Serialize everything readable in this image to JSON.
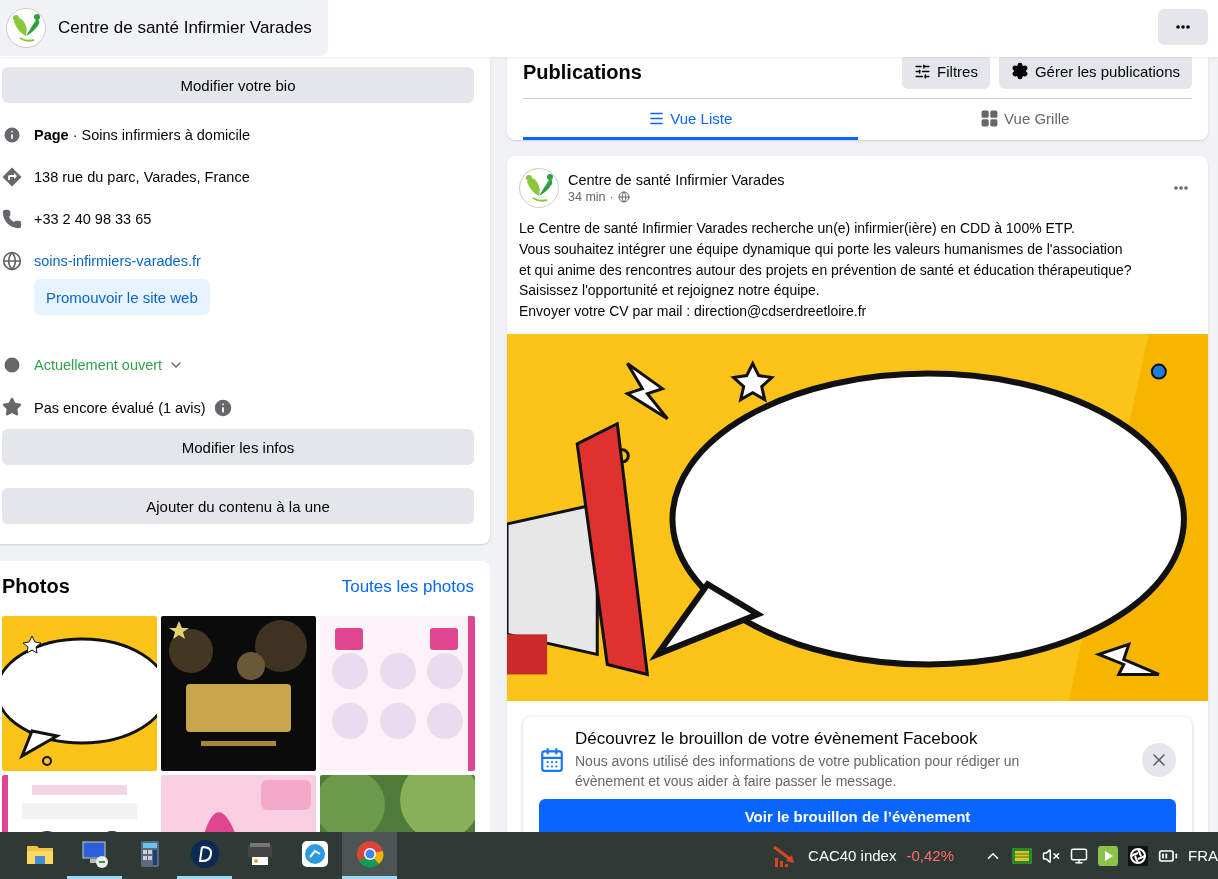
{
  "header": {
    "page_name": "Centre de santé Infirmier Varades"
  },
  "intro": {
    "edit_bio_button": "Modifier votre bio",
    "details": [
      {
        "kind": "category",
        "text": "**Page** · Soins infirmiers à domicile"
      },
      {
        "kind": "address",
        "text": "138 rue du parc, Varades, France"
      },
      {
        "kind": "phone",
        "text": "+33 2 40 98 33 65"
      },
      {
        "kind": "website",
        "text": "soins-infirmiers-varades.fr",
        "button": "Promouvoir le site web"
      },
      {
        "kind": "hours",
        "text": "Actuellement ouvert"
      },
      {
        "kind": "rating",
        "text": "Pas encore évalué (1 avis)"
      }
    ],
    "buttons": [
      "Modifier les infos",
      "Ajouter du contenu à la une"
    ]
  },
  "photos": {
    "title": "Photos",
    "link": "Toutes les photos",
    "items": [
      {
        "kind": "picture"
      },
      {
        "kind": "picture"
      },
      {
        "kind": "picture"
      },
      {
        "kind": "picture"
      },
      {
        "kind": "picture"
      },
      {
        "kind": "picture"
      }
    ]
  },
  "publications": {
    "title": "Publications",
    "actions": [
      {
        "kind": "filters",
        "label": "Filtres"
      },
      {
        "kind": "manage",
        "label": "Gérer les publications"
      }
    ],
    "tabs": [
      {
        "kind": "list",
        "label": "Vue Liste",
        "selected": true
      },
      {
        "kind": "grid",
        "label": "Vue Grille",
        "selected": false
      }
    ]
  },
  "post": {
    "author": "Centre de santé Infirmier Varades",
    "time": "34 min",
    "separator": "·",
    "lines": [
      "Le Centre de santé Infirmier Varades recherche un(e) infirmier(ière) en CDD à 100% ETP.",
      "Vous souhaitez intégrer une équipe dynamique qui porte les valeurs humanismes de l'association",
      "et qui anime des rencontres autour des projets en prévention de santé et éducation thérapeutique?",
      "Saisissez l'opportunité et rejoignez notre équipe.",
      "Envoyer votre CV par mail : direction@cdserdreetloire.fr"
    ],
    "image": {
      "kind": "picture"
    }
  },
  "event_prompt": {
    "title": "Découvrez le brouillon de votre évènement Facebook",
    "text": "Nous avons utilisé des informations de votre publication pour rédiger un évènement et vous aider à faire passer le message.",
    "button": "Voir le brouillon de l’évènement"
  },
  "taskbar": {
    "apps": [
      {
        "kind": "folder",
        "running": false,
        "selected": false
      },
      {
        "kind": "remote",
        "running": true,
        "selected": false
      },
      {
        "kind": "calculator",
        "running": false,
        "selected": false
      },
      {
        "kind": "dapp",
        "running": true,
        "selected": false
      },
      {
        "kind": "scanner",
        "running": false,
        "selected": false
      },
      {
        "kind": "share",
        "running": false,
        "selected": false
      },
      {
        "kind": "browser",
        "running": true,
        "selected": true
      }
    ],
    "ticker": {
      "name": "CAC40 index",
      "change": "-0,42%"
    },
    "language": "FRA"
  }
}
